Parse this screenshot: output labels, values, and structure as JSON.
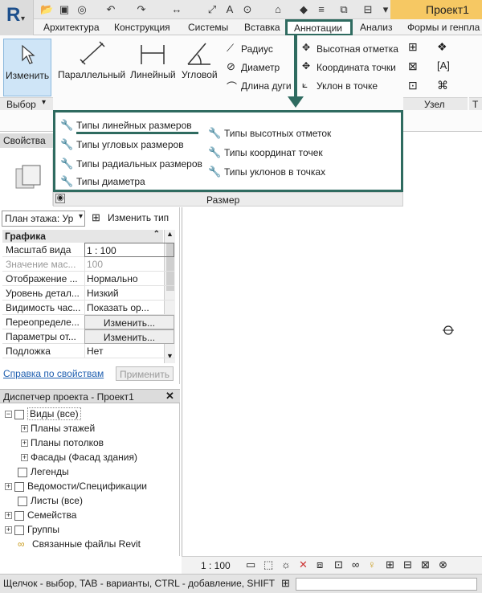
{
  "window": {
    "title": "Проект1"
  },
  "tabs": [
    "Архитектура",
    "Конструкция",
    "Системы",
    "Вставка",
    "Аннотации",
    "Анализ",
    "Формы и генпла"
  ],
  "active_tab": "Аннотации",
  "ribbon": {
    "modify_label": "Изменить",
    "dim_buttons": [
      "Параллельный",
      "Линейный",
      "Угловой"
    ],
    "dim_small": [
      "Радиус",
      "Диаметр",
      "Длина дуги"
    ],
    "spot": [
      "Высотная отметка",
      "Координата точки",
      "Уклон  в точке"
    ],
    "panel_select": "Выбор",
    "panel_node": "Узел",
    "panel_t": "Т"
  },
  "dropdown": {
    "left_items": [
      "Типы линейных размеров",
      "Типы угловых размеров",
      "Типы радиальных размеров",
      "Типы диаметра"
    ],
    "right_items": [
      "Типы высотных отметок",
      "Типы координат точек",
      "Типы уклонов в точках"
    ],
    "footer": "Размер"
  },
  "properties": {
    "header": "Свойства",
    "type_selector": "План этажа: Ур",
    "edit_type": "Изменить тип",
    "section": "Графика",
    "rows": [
      {
        "k": "Масштаб вида",
        "v": "1 : 100"
      },
      {
        "k": "Значение мас...",
        "v": "100"
      },
      {
        "k": "Отображение ...",
        "v": "Нормально"
      },
      {
        "k": "Уровень детал...",
        "v": "Низкий"
      },
      {
        "k": "Видимость час...",
        "v": "Показать ор..."
      },
      {
        "k": "Переопределе...",
        "v": "Изменить..."
      },
      {
        "k": "Параметры от...",
        "v": "Изменить..."
      },
      {
        "k": "Подложка",
        "v": "Нет"
      }
    ],
    "help_link": "Справка по свойствам",
    "apply": "Применить"
  },
  "project_browser": {
    "title": "Диспетчер проекта - Проект1",
    "items": [
      "Виды (все)",
      "Планы этажей",
      "Планы потолков",
      "Фасады (Фасад здания)",
      "Легенды",
      "Ведомости/Спецификации",
      "Листы (все)",
      "Семейства",
      "Группы",
      "Связанные файлы Revit"
    ]
  },
  "viewbar": {
    "scale": "1 : 100"
  },
  "status": {
    "text": "Щелчок - выбор, TAB - варианты, CTRL - добавление, SHIFT - с"
  },
  "colors": {
    "highlight": "#2f6b60",
    "title_bg": "#f6c863",
    "modify_bg": "#cfe5f7"
  }
}
